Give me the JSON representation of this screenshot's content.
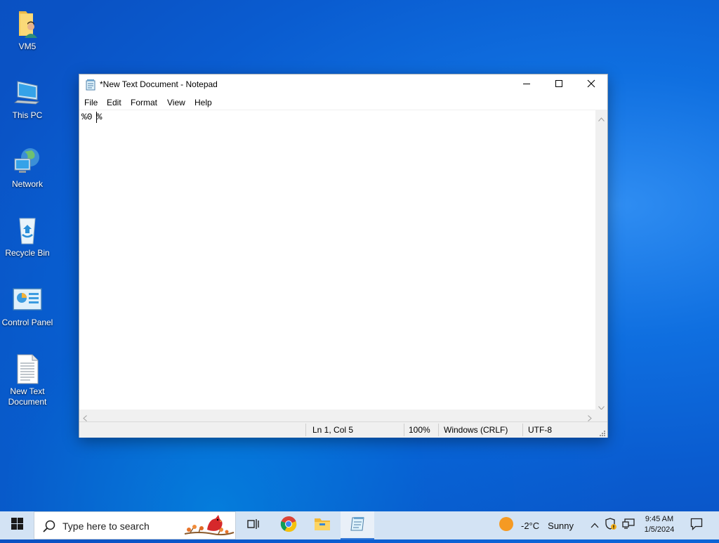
{
  "desktop": {
    "icons": [
      {
        "label": "VM5",
        "icon": "user-folder-icon"
      },
      {
        "label": "This PC",
        "icon": "this-pc-icon"
      },
      {
        "label": "Network",
        "icon": "network-icon"
      },
      {
        "label": "Recycle Bin",
        "icon": "recycle-bin-icon"
      },
      {
        "label": "Control Panel",
        "icon": "control-panel-icon"
      },
      {
        "label_line1": "New Text",
        "label_line2": "Document",
        "icon": "text-document-icon"
      }
    ]
  },
  "window": {
    "title": "*New Text Document - Notepad",
    "menu": [
      "File",
      "Edit",
      "Format",
      "View",
      "Help"
    ],
    "content_before_caret": "%0",
    "content_after_caret": "%",
    "status": {
      "position": "Ln 1, Col 5",
      "zoom": "100%",
      "line_ending": "Windows (CRLF)",
      "encoding": "UTF-8"
    }
  },
  "taskbar": {
    "search_placeholder": "Type here to search",
    "weather_temp": "-2°C",
    "weather_desc": "Sunny",
    "time": "9:45 AM",
    "date": "1/5/2024"
  },
  "colors": {
    "taskbar_bg": "#d3e3f4",
    "accent": "#3a7bd5",
    "desktop_blue": "#0a5cd0"
  }
}
